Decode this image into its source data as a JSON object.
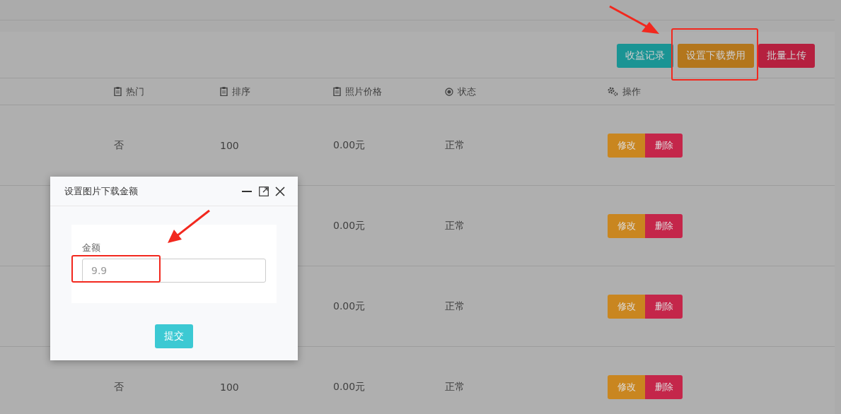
{
  "toolbar": {
    "buttons": [
      {
        "label": "收益记录",
        "kind": "teal"
      },
      {
        "label": "设置下载费用",
        "kind": "orange"
      },
      {
        "label": "批量上传",
        "kind": "red"
      }
    ]
  },
  "table": {
    "columns": [
      {
        "label": "热门",
        "kind": "text"
      },
      {
        "label": "排序",
        "kind": "text"
      },
      {
        "label": "照片价格",
        "kind": "text"
      },
      {
        "label": "状态",
        "kind": "status"
      },
      {
        "label": "操作",
        "kind": "action"
      }
    ],
    "rows": [
      {
        "hot": "否",
        "sort": "100",
        "price": "0.00元",
        "status": "正常",
        "actions": [
          "修改",
          "删除"
        ]
      },
      {
        "price": "0.00元",
        "status": "正常",
        "actions": [
          "修改",
          "删除"
        ]
      },
      {
        "price": "0.00元",
        "status": "正常",
        "actions": [
          "修改",
          "删除"
        ]
      },
      {
        "hot": "否",
        "sort": "100",
        "price": "0.00元",
        "status": "正常",
        "actions": [
          "修改",
          "删除"
        ]
      }
    ]
  },
  "dialog": {
    "title": "设置图片下载金额",
    "field": {
      "label": "金额",
      "value": "9.9"
    },
    "submit": "提交"
  }
}
